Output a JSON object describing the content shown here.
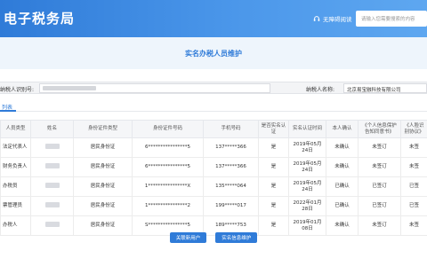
{
  "header": {
    "site_title": "电子税务局",
    "accessibility_label": "无障碍阅读",
    "search_placeholder": "请输入您需要搜索的内容"
  },
  "page": {
    "title": "实名办税人员维护"
  },
  "taxpayer": {
    "id_label": "纳税人识别号:",
    "name_label": "纳税人名称:",
    "name_value": "北京易宝融科技有限公司"
  },
  "list_tab": "列表",
  "table": {
    "headers": [
      "人员类型",
      "姓名",
      "身份证件类型",
      "身份证件号码",
      "手机号码",
      "是否实名认证",
      "实名认证时间",
      "本人确认",
      "《个人信息保护告知同意书》",
      "《人脸识别协议》"
    ],
    "rows": [
      {
        "type": "法定代表人",
        "id_type": "居民身份证",
        "id_no": "6****************5",
        "phone": "137*****366",
        "verified": "是",
        "time": "2019年05月24日",
        "confirm": "未确认",
        "consent": "未签订",
        "face": "未签"
      },
      {
        "type": "财务负责人",
        "id_type": "居民身份证",
        "id_no": "6****************5",
        "phone": "137*****366",
        "verified": "是",
        "time": "2019年05月24日",
        "confirm": "未确认",
        "consent": "未签订",
        "face": "未签"
      },
      {
        "type": "办税员",
        "id_type": "居民身份证",
        "id_no": "1****************X",
        "phone": "135*****064",
        "verified": "是",
        "time": "2019年05月24日",
        "confirm": "已确认",
        "consent": "已签订",
        "face": "已签"
      },
      {
        "type": "票管理员",
        "id_type": "居民身份证",
        "id_no": "1****************2",
        "phone": "199*****017",
        "verified": "是",
        "time": "2022年01月28日",
        "confirm": "已确认",
        "consent": "已签订",
        "face": "已签"
      },
      {
        "type": "办税人",
        "id_type": "居民身份证",
        "id_no": "S****************5",
        "phone": "189*****753",
        "verified": "是",
        "time": "2019年01月08日",
        "confirm": "未确认",
        "consent": "未签订",
        "face": "未签"
      }
    ]
  },
  "buttons": {
    "add_user": "关联新用户",
    "real_name": "实名信息维护"
  },
  "colors": {
    "brand": "#2f7bd8",
    "header_gradient_end": "#5ea7f0"
  },
  "icons": {
    "accessibility": "headphone-icon"
  }
}
